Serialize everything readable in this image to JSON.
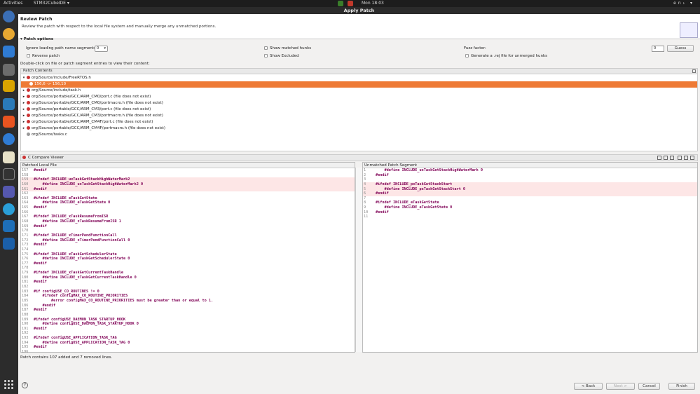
{
  "topbar": {
    "activities": "Activities",
    "app": "STM32CubeIDE ▾",
    "clock": "Mon 18:03",
    "right": "en₁ ▾"
  },
  "window": {
    "title": "Apply Patch"
  },
  "header": {
    "title": "Review Patch",
    "desc": "Review the patch with respect to the local file system and manually merge any unmatched portions."
  },
  "options": {
    "section": "Patch options",
    "ignore_label": "Ignore leading path name segments:",
    "ignore_value": "0",
    "show_matched": "Show matched hunks",
    "show_excluded": "Show Excluded",
    "reverse": "Reverse patch",
    "fuzz_label": "Fuzz factor:",
    "fuzz_value": "0",
    "guess": "Guess",
    "generate_rej": "Generate a .rej file for unmerged hunks",
    "hint": "Double-click on file or patch segment entries to view their content:"
  },
  "patch_contents": {
    "label": "Patch Contents",
    "items": [
      {
        "text": "org/Source/include/FreeRTOS.h",
        "expanded": true
      },
      {
        "text": "156,6 -> 156,10",
        "child": true,
        "selected": true
      },
      {
        "text": "org/Source/include/task.h"
      },
      {
        "text": "org/Source/portable/GCC/ARM_CM0/port.c (file does not exist)"
      },
      {
        "text": "org/Source/portable/GCC/ARM_CM0/portmacro.h (file does not exist)"
      },
      {
        "text": "org/Source/portable/GCC/ARM_CM3/port.c (file does not exist)"
      },
      {
        "text": "org/Source/portable/GCC/ARM_CM3/portmacro.h (file does not exist)"
      },
      {
        "text": "org/Source/portable/GCC/ARM_CM4F/port.c (file does not exist)"
      },
      {
        "text": "org/Source/portable/GCC/ARM_CM4F/portmacro.h (file does not exist)"
      },
      {
        "text": "org/Source/tasks.c",
        "ok": true
      }
    ]
  },
  "compare": {
    "title": "C Compare Viewer",
    "left_title": "Patched Local File",
    "right_title": "Unmatched Patch Segment",
    "left_lines": [
      [
        "157",
        "#endif"
      ],
      [
        "158",
        ""
      ],
      [
        "159",
        "#ifndef INCLUDE_uxTaskGetStackHighWaterMark2"
      ],
      [
        "160",
        "    #define INCLUDE_uxTaskGetStackHighWaterMark2 0"
      ],
      [
        "161",
        "#endif"
      ],
      [
        "162",
        ""
      ],
      [
        "163",
        "#ifndef INCLUDE_eTaskGetState"
      ],
      [
        "164",
        "    #define INCLUDE_eTaskGetState 0"
      ],
      [
        "165",
        "#endif"
      ],
      [
        "166",
        ""
      ],
      [
        "167",
        "#ifndef INCLUDE_xTaskResumeFromISR"
      ],
      [
        "168",
        "    #define INCLUDE_xTaskResumeFromISR 1"
      ],
      [
        "169",
        "#endif"
      ],
      [
        "170",
        ""
      ],
      [
        "171",
        "#ifndef INCLUDE_xTimerPendFunctionCall"
      ],
      [
        "172",
        "    #define INCLUDE_xTimerPendFunctionCall 0"
      ],
      [
        "173",
        "#endif"
      ],
      [
        "174",
        ""
      ],
      [
        "175",
        "#ifndef INCLUDE_xTaskGetSchedulerState"
      ],
      [
        "176",
        "    #define INCLUDE_xTaskGetSchedulerState 0"
      ],
      [
        "177",
        "#endif"
      ],
      [
        "178",
        ""
      ],
      [
        "179",
        "#ifndef INCLUDE_xTaskGetCurrentTaskHandle"
      ],
      [
        "180",
        "    #define INCLUDE_xTaskGetCurrentTaskHandle 0"
      ],
      [
        "181",
        "#endif"
      ],
      [
        "182",
        ""
      ],
      [
        "183",
        "#if configUSE_CO_ROUTINES != 0"
      ],
      [
        "184",
        "    #ifndef configMAX_CO_ROUTINE_PRIORITIES"
      ],
      [
        "185",
        "        #error configMAX_CO_ROUTINE_PRIORITIES must be greater than or equal to 1."
      ],
      [
        "186",
        "    #endif"
      ],
      [
        "187",
        "#endif"
      ],
      [
        "188",
        ""
      ],
      [
        "189",
        "#ifndef configUSE_DAEMON_TASK_STARTUP_HOOK"
      ],
      [
        "190",
        "    #define configUSE_DAEMON_TASK_STARTUP_HOOK 0"
      ],
      [
        "191",
        "#endif"
      ],
      [
        "192",
        ""
      ],
      [
        "193",
        "#ifndef configUSE_APPLICATION_TASK_TAG"
      ],
      [
        "194",
        "    #define configUSE_APPLICATION_TASK_TAG 0"
      ],
      [
        "195",
        "#endif"
      ],
      [
        "196",
        ""
      ]
    ],
    "right_lines": [
      [
        "1",
        "    #define INCLUDE_uxTaskGetStackHighWaterMark 0"
      ],
      [
        "2",
        "#endif"
      ],
      [
        "3",
        ""
      ],
      [
        "4",
        "#ifndef INCLUDE_pxTaskGetStackStart"
      ],
      [
        "5",
        "    #define INCLUDE_pxTaskGetStackStart 0"
      ],
      [
        "6",
        "#endif"
      ],
      [
        "7",
        ""
      ],
      [
        "8",
        "#ifndef INCLUDE_eTaskGetState"
      ],
      [
        "9",
        "    #define INCLUDE_eTaskGetState 0"
      ],
      [
        "10",
        "#endif"
      ],
      [
        "11",
        ""
      ]
    ]
  },
  "status": "Patch contains 107 added and 7 removed lines.",
  "footer": {
    "back": "< Back",
    "next": "Next >",
    "cancel": "Cancel",
    "finish": "Finish"
  }
}
